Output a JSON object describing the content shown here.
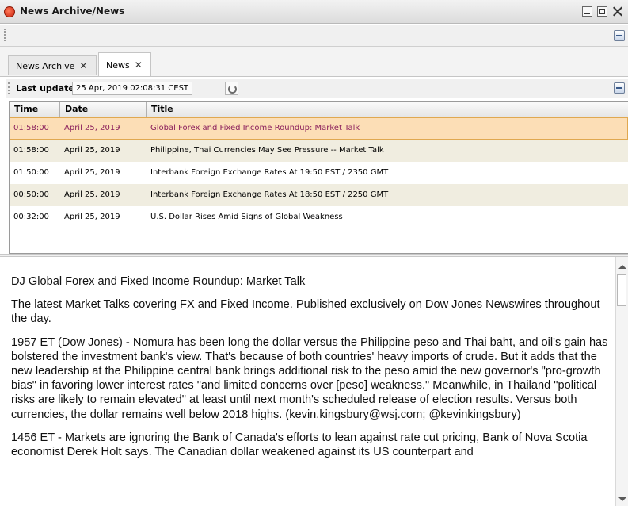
{
  "window": {
    "title": "News Archive/News"
  },
  "tabs": [
    {
      "label": "News Archive",
      "active": false
    },
    {
      "label": "News",
      "active": true
    }
  ],
  "last_updated": {
    "label": "Last updated:",
    "value": "25 Apr, 2019 02:08:31 CEST"
  },
  "table": {
    "columns": [
      "Time",
      "Date",
      "Title"
    ],
    "rows": [
      {
        "time": "01:58:00",
        "date": "April 25, 2019",
        "title": "Global Forex and Fixed Income Roundup: Market Talk",
        "selected": true
      },
      {
        "time": "01:58:00",
        "date": "April 25, 2019",
        "title": "Philippine, Thai Currencies May See Pressure -- Market Talk"
      },
      {
        "time": "01:50:00",
        "date": "April 25, 2019",
        "title": "Interbank Foreign Exchange Rates At 19:50 EST / 2350 GMT"
      },
      {
        "time": "00:50:00",
        "date": "April 25, 2019",
        "title": "Interbank Foreign Exchange Rates At 18:50 EST / 2250 GMT"
      },
      {
        "time": "00:32:00",
        "date": "April 25, 2019",
        "title": "U.S. Dollar Rises Amid Signs of Global Weakness"
      }
    ]
  },
  "article": {
    "paragraphs": [
      "DJ Global Forex and Fixed Income Roundup: Market Talk",
      "The latest Market Talks covering FX and Fixed Income. Published exclusively on Dow Jones Newswires throughout the day.",
      "1957 ET (Dow Jones) - Nomura has been long the dollar versus the Philippine peso and Thai baht, and oil's gain has bolstered the investment bank's view. That's because of both countries' heavy imports of crude. But it adds that the new leadership at the Philippine central bank brings additional risk to the peso amid the new governor's \"pro-growth bias\" in favoring lower interest rates \"and limited concerns over [peso] weakness.\" Meanwhile, in Thailand \"political risks are likely to remain elevated\" at least until next month's scheduled release of election results. Versus both currencies, the dollar remains well below 2018 highs. (kevin.kingsbury@wsj.com; @kevinkingsbury)",
      "1456 ET - Markets are ignoring the Bank of Canada's efforts to lean against rate cut pricing, Bank of Nova Scotia economist Derek Holt says. The Canadian dollar weakened against its US counterpart and"
    ]
  },
  "icons": {
    "app": "app-logo-icon",
    "minimize": "minimize-icon",
    "maximize": "maximize-icon",
    "close": "close-icon",
    "toolbar_menu": "panel-menu-icon",
    "refresh": "refresh-icon"
  }
}
